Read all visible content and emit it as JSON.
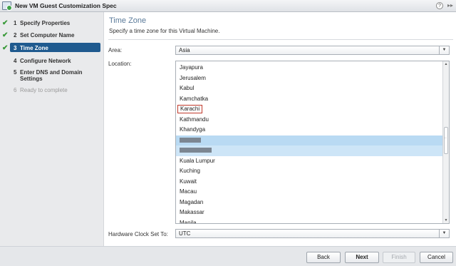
{
  "window": {
    "title": "New VM Guest Customization Spec",
    "help_glyph": "?",
    "expand_glyph": "▸▸"
  },
  "steps": [
    {
      "num": "1",
      "label": "Specify Properties",
      "state": "done"
    },
    {
      "num": "2",
      "label": "Set Computer Name",
      "state": "done"
    },
    {
      "num": "3",
      "label": "Time Zone",
      "state": "active"
    },
    {
      "num": "4",
      "label": "Configure Network",
      "state": "pending"
    },
    {
      "num": "5",
      "label": "Enter DNS and Domain Settings",
      "state": "pending"
    },
    {
      "num": "6",
      "label": "Ready to complete",
      "state": "disabled"
    }
  ],
  "check_glyph": "✔",
  "header": {
    "title": "Time Zone",
    "subtitle": "Specify a time zone for this Virtual Machine."
  },
  "area": {
    "label": "Area:",
    "value": "Asia"
  },
  "location": {
    "label": "Location:",
    "items": [
      {
        "text": "Jayapura"
      },
      {
        "text": "Jerusalem"
      },
      {
        "text": "Kabul"
      },
      {
        "text": "Kamchatka"
      },
      {
        "text": "Karachi",
        "boxed": true
      },
      {
        "text": "Kathmandu"
      },
      {
        "text": "Khandyga"
      },
      {
        "text": "",
        "redacted": "short",
        "state": "hl"
      },
      {
        "text": "",
        "redacted": "wide",
        "state": "sel"
      },
      {
        "text": "Kuala Lumpur"
      },
      {
        "text": "Kuching"
      },
      {
        "text": "Kuwait"
      },
      {
        "text": "Macau"
      },
      {
        "text": "Magadan"
      },
      {
        "text": "Makassar"
      },
      {
        "text": "Manila"
      }
    ]
  },
  "hwclock": {
    "label": "Hardware Clock Set To:",
    "value": "UTC"
  },
  "buttons": {
    "back": "Back",
    "next": "Next",
    "finish": "Finish",
    "cancel": "Cancel"
  },
  "colors": {
    "accent": "#1f5a8f",
    "done_check": "#3a9a3a",
    "selection": "#cde5f7",
    "highlight_box": "#c0392b"
  }
}
